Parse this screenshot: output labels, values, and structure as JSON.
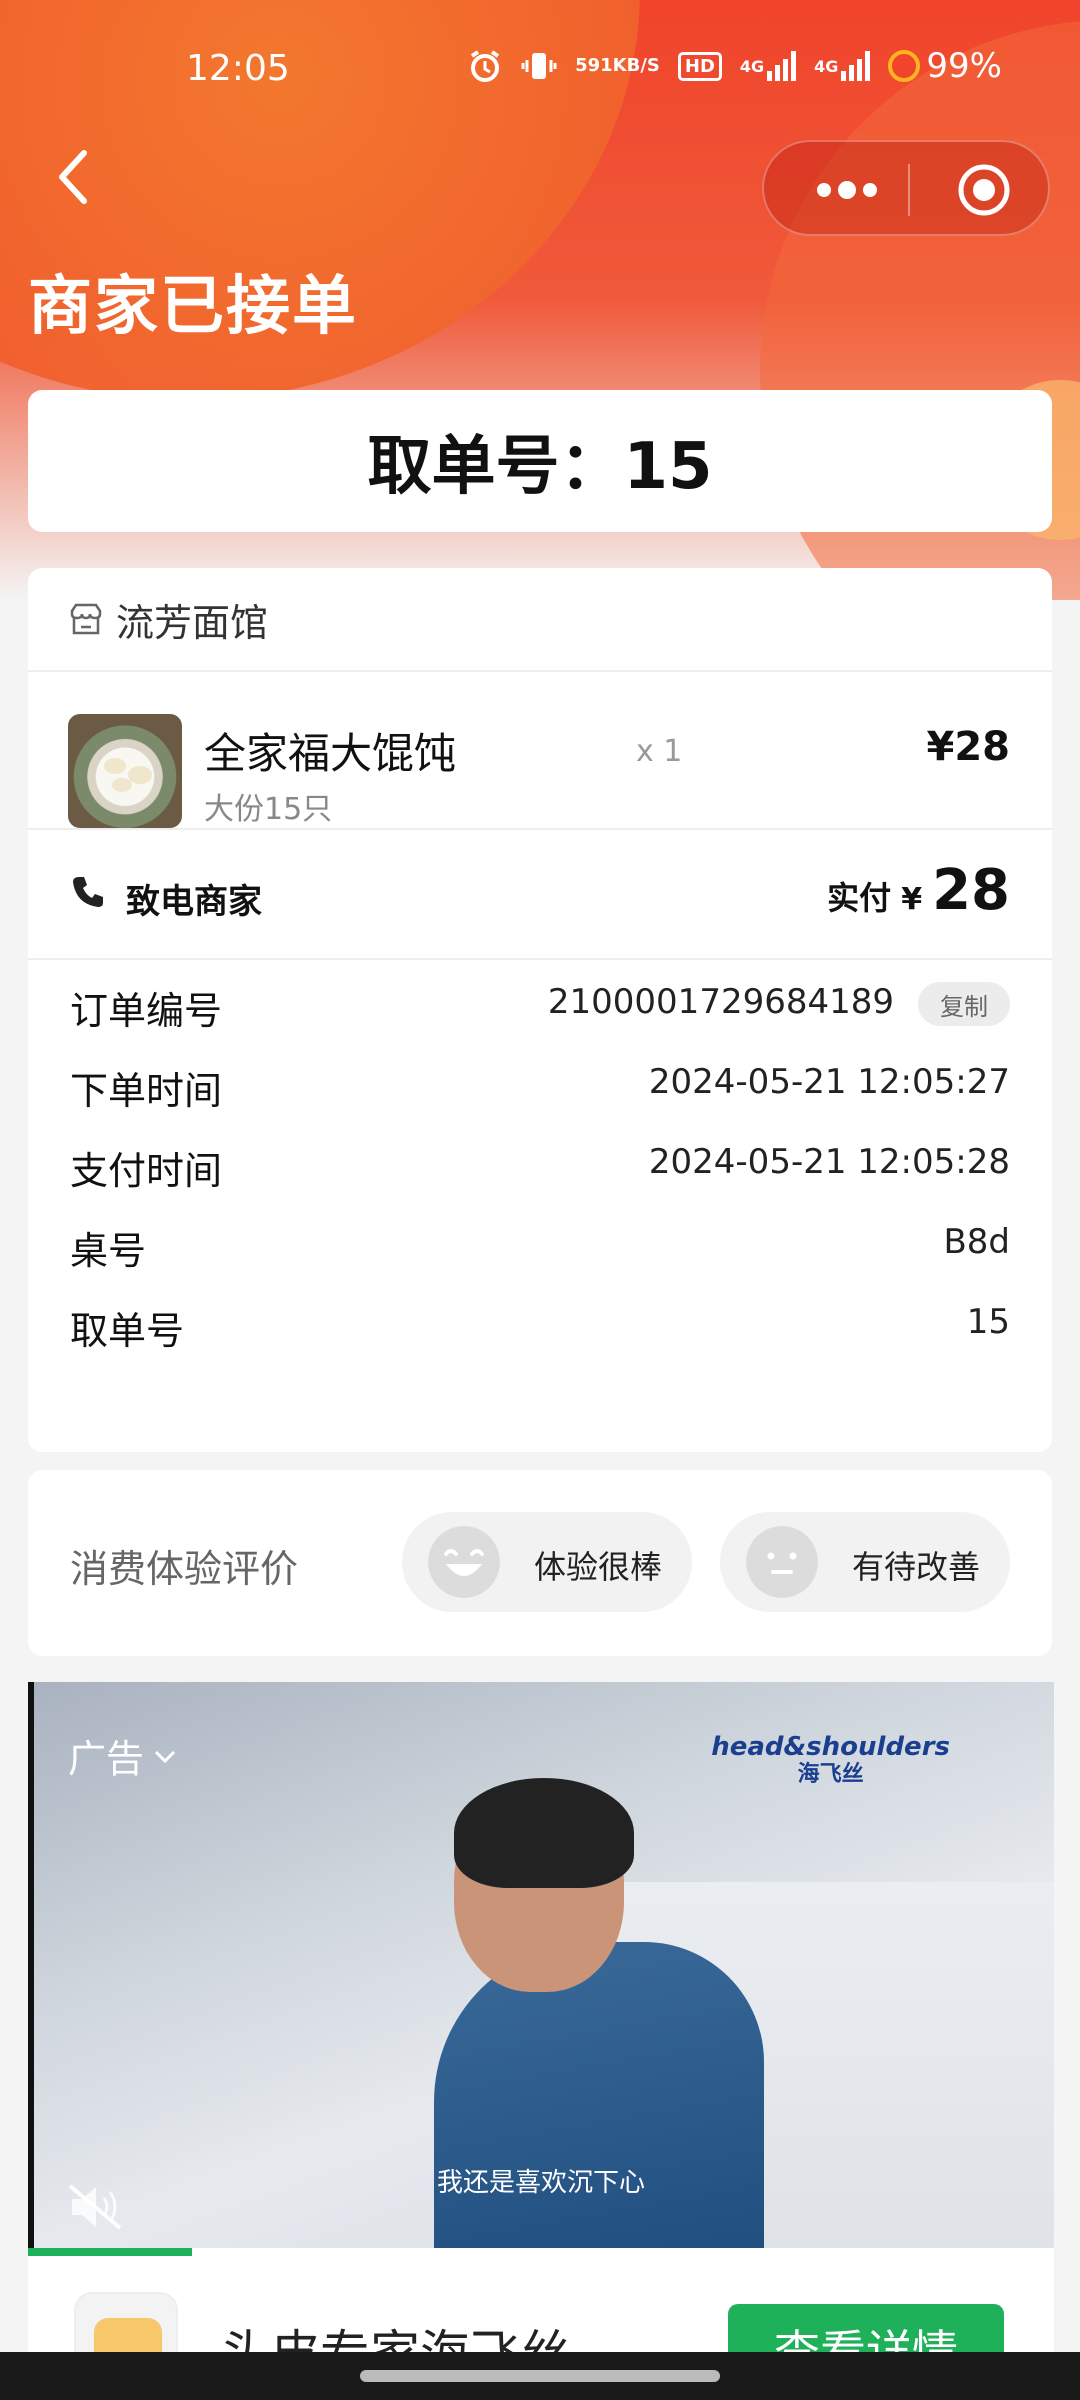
{
  "status_bar": {
    "time": "12:05",
    "net_speed_value": "591",
    "net_speed_unit": "KB/S",
    "hd_label": "HD",
    "signal1_label": "4G",
    "signal2_label": "4G",
    "battery": "99%"
  },
  "header": {
    "title": "商家已接单"
  },
  "pickup": {
    "text": "取单号：15"
  },
  "order": {
    "shop_name": "流芳面馆",
    "item": {
      "name": "全家福大馄饨",
      "spec": "大份15只",
      "qty": "x 1",
      "price": "¥28"
    },
    "call_label": "致电商家",
    "paid_label": "实付",
    "paid_currency": "¥",
    "paid_amount": "28",
    "copy_label": "复制",
    "info": [
      {
        "key": "订单编号",
        "value": "2100001729684189"
      },
      {
        "key": "下单时间",
        "value": "2024-05-21 12:05:27"
      },
      {
        "key": "支付时间",
        "value": "2024-05-21 12:05:28"
      },
      {
        "key": "桌号",
        "value": "B8d"
      },
      {
        "key": "取单号",
        "value": "15"
      }
    ]
  },
  "rating": {
    "label": "消费体验评价",
    "good": "体验很棒",
    "improve": "有待改善"
  },
  "ad": {
    "label": "广告",
    "brand_line1": "head&shoulders",
    "brand_line2": "海飞丝",
    "subtitle": "我还是喜欢沉下心",
    "progress": 0.16,
    "footer_title": "头皮专家海飞丝",
    "cta": "查看详情"
  },
  "colors": {
    "accent_red": "#f0442b",
    "cta_green": "#1fb05a"
  }
}
